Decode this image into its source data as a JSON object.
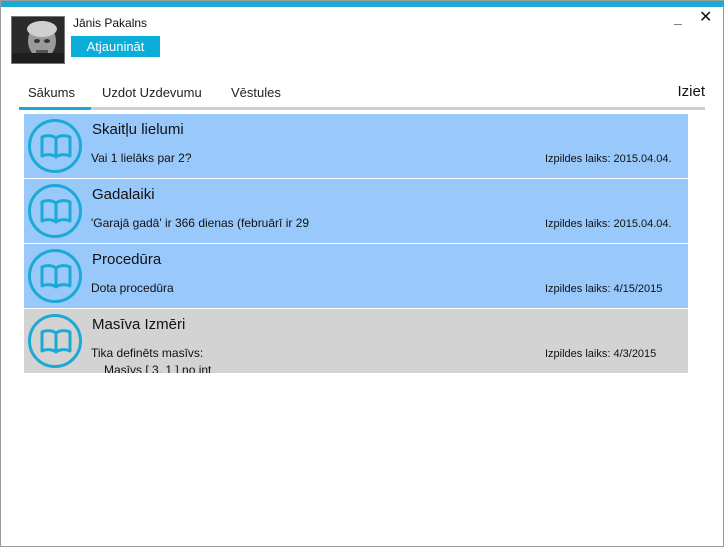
{
  "user": {
    "name": "Jānis Pakalns",
    "refresh_label": "Atjaunināt"
  },
  "window": {
    "minimize_glyph": "_",
    "close_glyph": "✕"
  },
  "tabs": [
    {
      "label": "Sākums",
      "active": true
    },
    {
      "label": "Uzdot Uzdevumu",
      "active": false
    },
    {
      "label": "Vēstules",
      "active": false
    }
  ],
  "logout_label": "Iziet",
  "tasks": [
    {
      "title": "Skaitļu lielumi",
      "description": "Vai 1 lielāks par 2?",
      "description_line2": "",
      "deadline": "Izpildes laiks: 2015.04.04.",
      "color": "#99c9fb"
    },
    {
      "title": "Gadalaiki",
      "description": "'Garajā gadā' ir 366 dienas (februārī ir 29",
      "description_line2": "",
      "deadline": "Izpildes laiks: 2015.04.04.",
      "color": "#99c9fb"
    },
    {
      "title": "Procedūra",
      "description": "Dota procedūra",
      "description_line2": "",
      "deadline": "Izpildes laiks: 4/15/2015",
      "color": "#99c9fb"
    },
    {
      "title": "Masīva Izmēri",
      "description": "Tika definēts masīvs:",
      "description_line2": "Masīvs [ 3, 1 ] no int",
      "deadline": "Izpildes laiks: 4/3/2015",
      "color": "#d3d3d3"
    }
  ],
  "colors": {
    "accent": "#1ba9d6",
    "task_blue": "#99c9fb",
    "task_gray": "#d3d3d3"
  },
  "icons": {
    "task_icon": "book-icon"
  }
}
